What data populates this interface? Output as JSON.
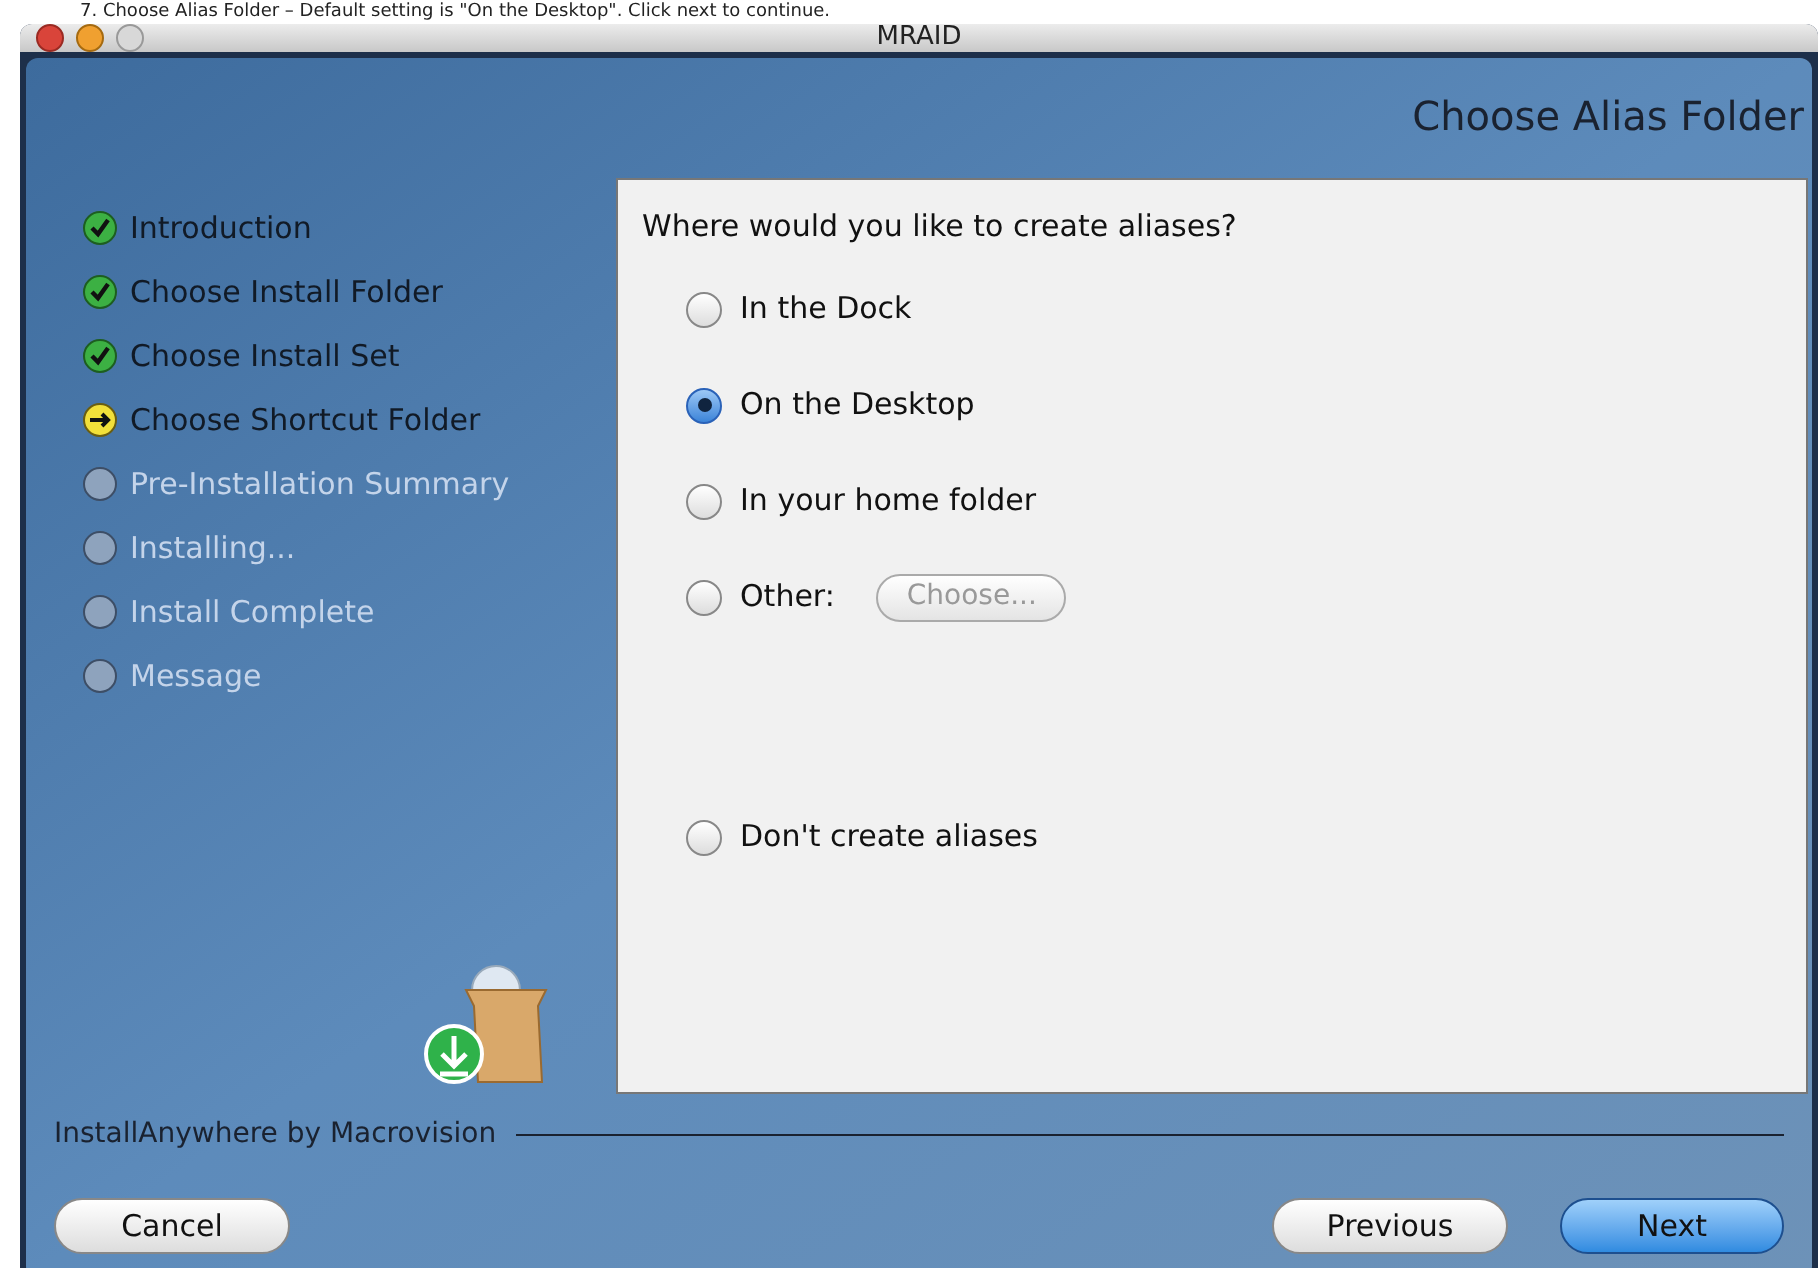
{
  "caption": "7. Choose Alias Folder – Default setting is \"On the Desktop\". Click next to continue.",
  "window": {
    "title": "MRAID"
  },
  "header": "Choose Alias Folder",
  "steps": [
    {
      "label": "Introduction",
      "kind": "done"
    },
    {
      "label": "Choose Install Folder",
      "kind": "done"
    },
    {
      "label": "Choose Install Set",
      "kind": "done"
    },
    {
      "label": "Choose Shortcut Folder",
      "kind": "current"
    },
    {
      "label": "Pre-Installation Summary",
      "kind": "pending"
    },
    {
      "label": "Installing...",
      "kind": "pending"
    },
    {
      "label": "Install Complete",
      "kind": "pending"
    },
    {
      "label": "Message",
      "kind": "pending"
    }
  ],
  "question": "Where would you like to create aliases?",
  "options": [
    {
      "label": "In the Dock",
      "selected": false
    },
    {
      "label": "On the Desktop",
      "selected": true
    },
    {
      "label": "In your home folder",
      "selected": false
    },
    {
      "label": "Other:",
      "selected": false,
      "button": {
        "label": "Choose...",
        "disabled": true
      }
    },
    {
      "label": "Don't create aliases",
      "selected": false,
      "gap": true
    }
  ],
  "brand": "InstallAnywhere by Macrovision",
  "buttons": {
    "cancel": "Cancel",
    "previous": "Previous",
    "next": "Next"
  }
}
